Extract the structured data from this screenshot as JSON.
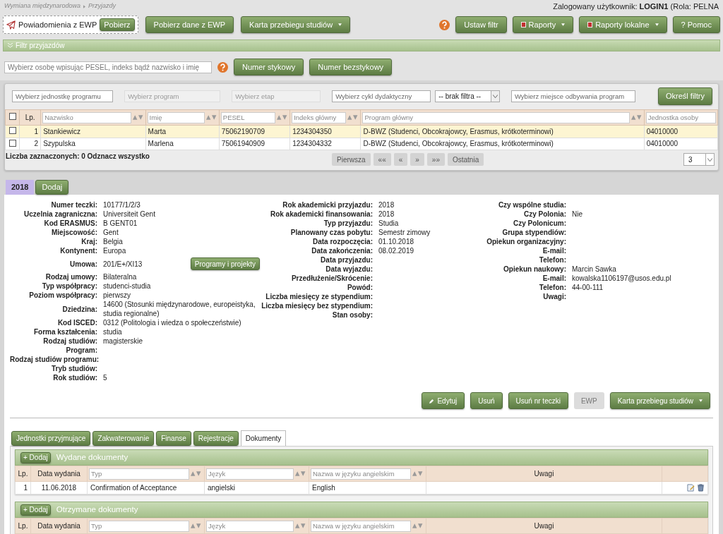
{
  "breadcrumb": [
    "Wymiana międzynarodowa",
    "Przyjazdy"
  ],
  "user_info": "Zalogowany użytkownik: **LOGIN1** (Rola: PELNA",
  "ewp_notice": {
    "label": "Powiadomienia z EWP",
    "button": "Pobierz"
  },
  "left_buttons": [
    {
      "label": "Pobierz dane z EWP",
      "dropdown": false
    },
    {
      "label": "Karta przebiegu studiów",
      "dropdown": true
    }
  ],
  "right_buttons": [
    {
      "label": "Ustaw filtr",
      "kind": "plain",
      "dropdown": false
    },
    {
      "label": "Raporty",
      "kind": "report",
      "dropdown": true
    },
    {
      "label": "Raporty lokalne",
      "kind": "report",
      "dropdown": true
    },
    {
      "label": "? Pomoc",
      "kind": "plain",
      "dropdown": false
    }
  ],
  "filter_bar": {
    "title": "Filtr przyjazdów"
  },
  "person_search": {
    "placeholder": "Wybierz osobę wpisując PESEL, indeks bądź nazwisko i imię",
    "buttons": [
      "Numer stykowy",
      "Numer bezstykowy"
    ]
  },
  "filters": [
    {
      "kind": "text",
      "placeholder": "Wybierz jednostkę programu",
      "disabled": false
    },
    {
      "kind": "text",
      "placeholder": "Wybierz program",
      "disabled": true
    },
    {
      "kind": "text",
      "placeholder": "Wybierz etap",
      "disabled": true
    },
    {
      "kind": "text",
      "placeholder": "Wybierz cykl dydaktyczny",
      "disabled": false
    },
    {
      "kind": "select",
      "value": "-- brak filtra --"
    },
    {
      "kind": "text",
      "placeholder": "Wybierz miejsce odbywania program",
      "disabled": false
    }
  ],
  "apply_filters": "Określ filtry",
  "table": {
    "select_all": {
      "checked": false
    },
    "columns": [
      {
        "label": "Lp.",
        "kind": "plain"
      },
      {
        "placeholder": "Nazwisko",
        "kind": "filter"
      },
      {
        "placeholder": "Imię",
        "kind": "filter"
      },
      {
        "placeholder": "PESEL",
        "kind": "filter"
      },
      {
        "placeholder": "Indeks główny",
        "kind": "filter"
      },
      {
        "placeholder": "Program główny",
        "kind": "filter"
      },
      {
        "placeholder": "Jednostka osoby",
        "kind": "filter"
      }
    ],
    "rows": [
      {
        "checked": false,
        "selected": true,
        "cells": [
          "1",
          "Stankiewicz",
          "Marta",
          "75062190709",
          "1234304350",
          "D-BWZ (Studenci, Obcokrajowcy, Erasmus, krótkoterminowi)",
          "04010000"
        ]
      },
      {
        "checked": false,
        "selected": false,
        "cells": [
          "2",
          "Szypulska",
          "Marlena",
          "75061940909",
          "1234304332",
          "D-BWZ (Studenci, Obcokrajowcy, Erasmus, krótkoterminowi)",
          "04010000"
        ]
      }
    ]
  },
  "selection_info": "Liczba zaznaczonych: 0 Odznacz wszystko",
  "pagination": [
    "Pierwsza",
    "««",
    "«",
    "»",
    "»»",
    "Ostatnia"
  ],
  "page_size": "3",
  "year_tabs": [
    {
      "label": "2018",
      "selected": true
    },
    {
      "label": "Dodaj",
      "selected": false
    }
  ],
  "details": [
    [
      {
        "label": "Numer teczki:",
        "value": "10177/1/2/3"
      },
      {
        "label": "Uczelnia zagraniczna:",
        "value": "Universiteit Gent"
      },
      {
        "label": "Kod ERASMUS:",
        "value": "B  GENT01"
      },
      {
        "label": "Miejscowość:",
        "value": "Gent"
      },
      {
        "label": "Kraj:",
        "value": "Belgia"
      },
      {
        "label": "Kontynent:",
        "value": "Europa"
      },
      {
        "label": "Umowa:",
        "value": "201/E+/XI13",
        "action": "Programy i projekty"
      },
      {
        "label": "Rodzaj umowy:",
        "value": "Bilateralna"
      },
      {
        "label": "Typ współpracy:",
        "value": "studenci-studia"
      },
      {
        "label": "Poziom współpracy:",
        "value": "pierwszy"
      },
      {
        "label": "Dziedzina:",
        "value": "14600 (Stosunki międzynarodowe, europeistyka, studia regionalne)"
      },
      {
        "label": "Kod ISCED:",
        "value": "0312 (Politologia i wiedza o społeczeństwie)"
      },
      {
        "label": "Forma kształcenia:",
        "value": "studia"
      },
      {
        "label": "Rodzaj studiów:",
        "value": "magisterskie"
      },
      {
        "label": "Program:"
      },
      {
        "label": "Rodzaj studiów programu:"
      },
      {
        "label": "Tryb studiów:"
      },
      {
        "label": "Rok studiów:",
        "value": "5"
      }
    ],
    [
      {
        "label": "Rok akademicki przyjazdu:",
        "value": "2018"
      },
      {
        "label": "Rok akademicki finansowania:",
        "value": "2018"
      },
      {
        "label": "Typ przyjazdu:",
        "value": "Studia"
      },
      {
        "label": "Planowany czas pobytu:",
        "value": "Semestr zimowy"
      },
      {
        "label": "Data rozpoczęcia:",
        "value": "01.10.2018"
      },
      {
        "label": "Data zakończenia:",
        "value": "08.02.2019"
      },
      {
        "label": "Data przyjazdu:"
      },
      {
        "label": "Data wyjazdu:"
      },
      {
        "label": "Przedłużenie/Skrócenie:"
      },
      {
        "label": "Powód:"
      },
      {
        "label": "Liczba miesięcy ze stypendium:"
      },
      {
        "label": "Liczba miesięcy bez stypendium:"
      },
      {
        "label": "Stan osoby:"
      }
    ],
    [
      {
        "label": "Czy wspólne studia:"
      },
      {
        "label": "Czy Polonia:",
        "value": "Nie"
      },
      {
        "label": "Czy Polonicum:"
      },
      {
        "label": "Grupa stypendiów:"
      },
      {
        "label": "Opiekun organizacyjny:"
      },
      {
        "label": "E-mail:"
      },
      {
        "label": "Telefon:"
      },
      {
        "label": "Opiekun naukowy:",
        "value": "Marcin Sawka"
      },
      {
        "label": "E-mail:",
        "value": "kowalska1106197@usos.edu.pl"
      },
      {
        "label": "Telefon:",
        "value": "44-00-111"
      },
      {
        "label": "Uwagi:"
      }
    ]
  ],
  "actions": [
    {
      "label": "Edytuj",
      "kind": "edit",
      "disabled": false,
      "dropdown": false
    },
    {
      "label": "Usuń",
      "kind": "plain",
      "disabled": false,
      "dropdown": false
    },
    {
      "label": "Usuń nr teczki",
      "kind": "plain",
      "disabled": false,
      "dropdown": false
    },
    {
      "label": "EWP",
      "kind": "plain",
      "disabled": true,
      "dropdown": false
    },
    {
      "label": "Karta przebiegu studiów",
      "kind": "plain",
      "disabled": false,
      "dropdown": true
    }
  ],
  "tabs": [
    {
      "label": "Jednostki przyjmujące",
      "selected": false
    },
    {
      "label": "Zakwaterowanie",
      "selected": false
    },
    {
      "label": "Finanse",
      "selected": false
    },
    {
      "label": "Rejestracje",
      "selected": false
    },
    {
      "label": "Dokumenty",
      "selected": true
    }
  ],
  "sections": [
    {
      "title": "Wydane dokumenty",
      "add_label": "+ Dodaj",
      "columns": [
        {
          "label": "Lp.",
          "kind": "plain"
        },
        {
          "label": "Data wydania",
          "kind": "plain"
        },
        {
          "placeholder": "Typ",
          "kind": "filter"
        },
        {
          "placeholder": "Język",
          "kind": "filter"
        },
        {
          "placeholder": "Nazwa w języku angielskim",
          "kind": "filter"
        },
        {
          "label": "Uwagi",
          "kind": "plain"
        }
      ],
      "rows": [
        {
          "cells": [
            "1",
            "11.06.2018",
            "Confirmation of Acceptance",
            "angielski",
            "English",
            ""
          ]
        }
      ]
    },
    {
      "title": "Otrzymane dokumenty",
      "add_label": "+ Dodaj",
      "columns": [
        {
          "label": "Lp.",
          "kind": "plain"
        },
        {
          "label": "Data wydania",
          "kind": "plain"
        },
        {
          "placeholder": "Typ",
          "kind": "filter"
        },
        {
          "placeholder": "Język",
          "kind": "filter"
        },
        {
          "placeholder": "Nazwa w języku angielskim",
          "kind": "filter"
        },
        {
          "label": "Uwagi",
          "kind": "plain"
        }
      ]
    }
  ]
}
